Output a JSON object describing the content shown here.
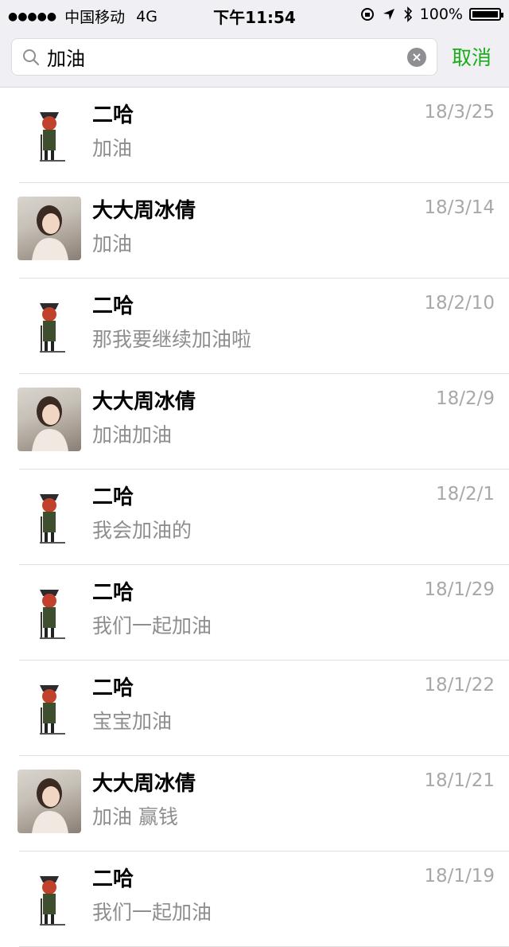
{
  "status_bar": {
    "signal": "●●●●●",
    "carrier": "中国移动",
    "network": "4G",
    "time": "下午11:54",
    "battery": "100%"
  },
  "search": {
    "query": "加油",
    "cancel_label": "取消"
  },
  "results": [
    {
      "name": "二哈",
      "message": "加油",
      "date": "18/3/25",
      "avatar": "cartoon-character"
    },
    {
      "name": "大大周冰倩",
      "message": "加油",
      "date": "18/3/14",
      "avatar": "girl-photo"
    },
    {
      "name": "二哈",
      "message": "那我要继续加油啦",
      "date": "18/2/10",
      "avatar": "cartoon-character"
    },
    {
      "name": "大大周冰倩",
      "message": "加油加油",
      "date": "18/2/9",
      "avatar": "girl-photo"
    },
    {
      "name": "二哈",
      "message": "我会加油的",
      "date": "18/2/1",
      "avatar": "cartoon-character"
    },
    {
      "name": "二哈",
      "message": "我们一起加油",
      "date": "18/1/29",
      "avatar": "cartoon-character"
    },
    {
      "name": "二哈",
      "message": "宝宝加油",
      "date": "18/1/22",
      "avatar": "cartoon-character"
    },
    {
      "name": "大大周冰倩",
      "message": "加油 赢钱",
      "date": "18/1/21",
      "avatar": "girl-photo"
    },
    {
      "name": "二哈",
      "message": "我们一起加油",
      "date": "18/1/19",
      "avatar": "cartoon-character"
    }
  ],
  "colors": {
    "accent": "#1aad19",
    "secondary_text": "#8e8e8e",
    "date_text": "#a8a8a8"
  }
}
